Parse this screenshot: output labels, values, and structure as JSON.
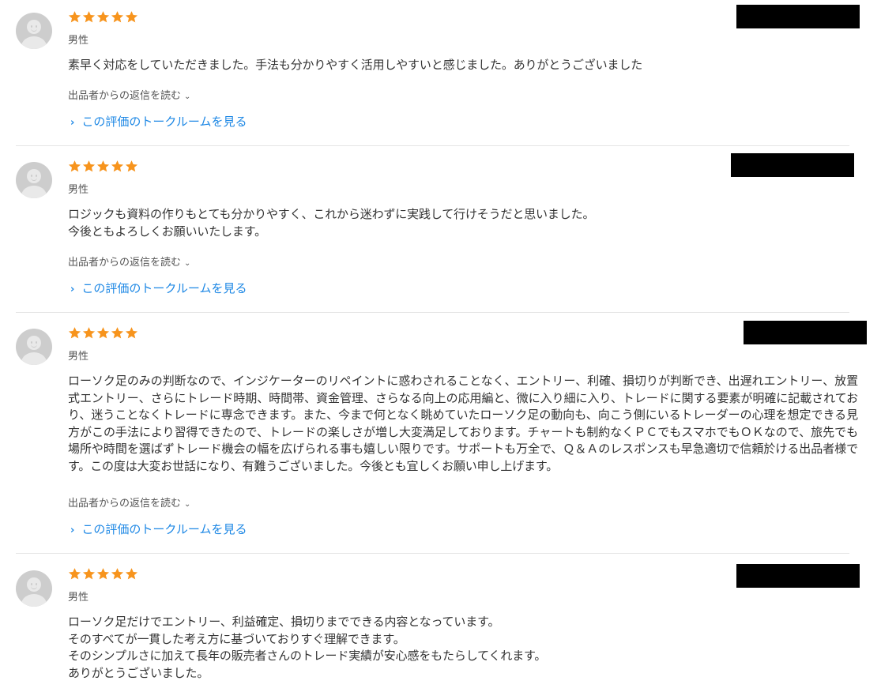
{
  "reviews": [
    {
      "rating": 5,
      "gender": "男性",
      "comment": "素早く対応をしていただきました。手法も分かりやすく活用しやすいと感じました。ありがとうございました",
      "reply_label": "出品者からの返信を読む",
      "talk_label": "この評価のトークルームを見る"
    },
    {
      "rating": 5,
      "gender": "男性",
      "comment": "ロジックも資料の作りもとても分かりやすく、これから迷わずに実践して行けそうだと思いました。\n今後ともよろしくお願いいたします。",
      "reply_label": "出品者からの返信を読む",
      "talk_label": "この評価のトークルームを見る"
    },
    {
      "rating": 5,
      "gender": "男性",
      "comment": "ローソク足のみの判断なので、インジケーターのリペイントに惑わされることなく、エントリー、利確、損切りが判断でき、出遅れエントリー、放置式エントリー、さらにトレード時期、時間帯、資金管理、さらなる向上の応用編と、微に入り細に入り、トレードに関する要素が明確に記載されており、迷うことなくトレードに専念できます。また、今まで何となく眺めていたローソク足の動向も、向こう側にいるトレーダーの心理を想定できる見方がこの手法により習得できたので、トレードの楽しさが増し大変満足しております。チャートも制約なくＰＣでもスマホでもＯＫなので、旅先でも場所や時間を選ばずトレード機会の幅を広げられる事も嬉しい限りです。サポートも万全で、Ｑ＆Ａのレスポンスも早急適切で信頼於ける出品者様です。この度は大変お世話になり、有難うございました。今後とも宜しくお願い申し上げます。",
      "reply_label": "出品者からの返信を読む",
      "talk_label": "この評価のトークルームを見る"
    },
    {
      "rating": 5,
      "gender": "男性",
      "comment": "ローソク足だけでエントリー、利益確定、損切りまでできる内容となっています。\nそのすべてが一貫した考え方に基づいておりすぐ理解できます。\nそのシンプルさに加えて長年の販売者さんのトレード実績が安心感をもたらしてくれます。\nありがとうございました。"
    }
  ],
  "colors": {
    "star": "#f7941d",
    "link": "#1e88e5",
    "redaction": "#000000"
  },
  "icons": {
    "rating": "star-icon",
    "reply_toggle": "chevron-down-icon",
    "talk": "chevron-right-icon",
    "avatar": "user-avatar-icon"
  }
}
